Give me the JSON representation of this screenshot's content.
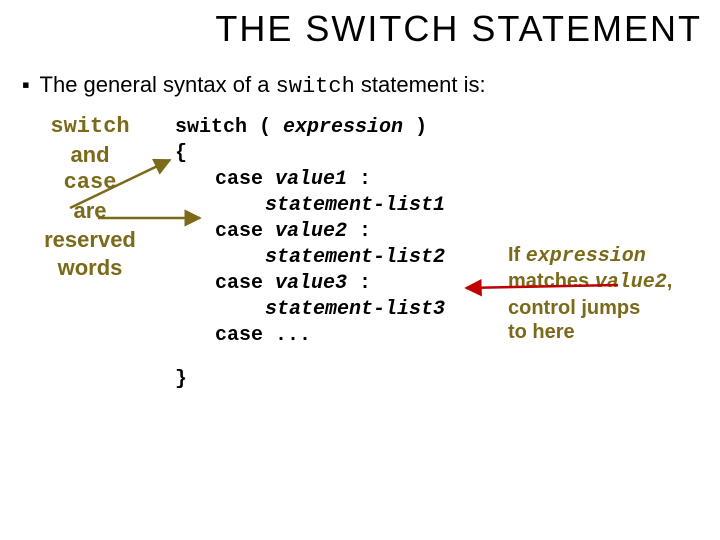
{
  "title": "THE SWITCH STATEMENT",
  "intro_prefix": "The general syntax of a ",
  "intro_code": "switch",
  "intro_suffix": " statement is:",
  "left": {
    "w1": "switch",
    "l1": "and",
    "w2": "case",
    "l2": "are",
    "l3": "reserved",
    "l4": "words"
  },
  "code": {
    "l1_a": "switch ( ",
    "l1_b": "expression",
    "l1_c": " )",
    "l2": "{",
    "l3_a": "case ",
    "l3_b": "value1",
    "l3_c": " :",
    "l4": "statement-list1",
    "l5_a": "case ",
    "l5_b": "value2",
    "l5_c": " :",
    "l6": "statement-list2",
    "l7_a": "case ",
    "l7_b": "value3",
    "l7_c": " :",
    "l8": "statement-list3",
    "l9": "case  ...",
    "l10": "}"
  },
  "right": {
    "p_a": "If ",
    "p_b": "expression",
    "p_c": "matches ",
    "p_d": "value2",
    "p_e": ",",
    "p_f": "control jumps",
    "p_g": "to here"
  }
}
